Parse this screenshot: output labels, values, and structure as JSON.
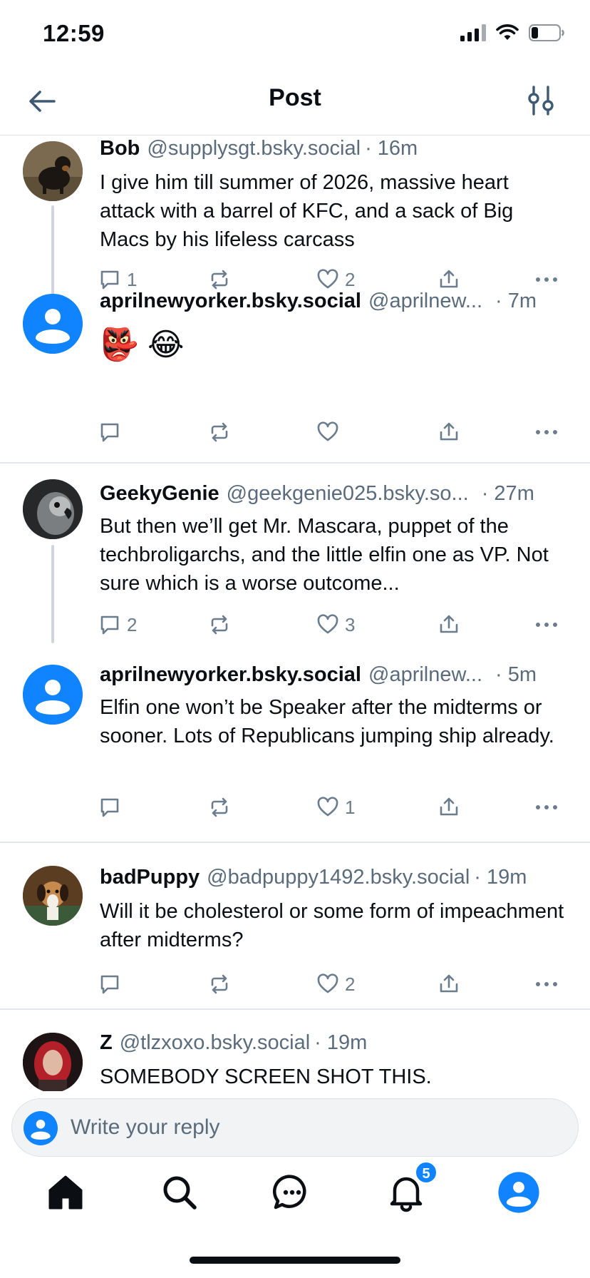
{
  "status_bar": {
    "time": "12:59"
  },
  "header": {
    "title": "Post"
  },
  "posts": [
    {
      "name": "Bob",
      "handle": "@supplysgt.bsky.social",
      "time": "· 16m",
      "text": "I give him till summer of 2026, massive heart attack with a barrel of KFC, and a sack of Big Macs by his lifeless carcass",
      "replies": "1",
      "likes": "2"
    },
    {
      "name": "aprilnewyorker.bsky.social",
      "handle": "@aprilnew...",
      "time": "· 7m",
      "text": "👺 😂",
      "replies": "",
      "likes": ""
    },
    {
      "name": "GeekyGenie",
      "handle": "@geekgenie025.bsky.so...",
      "time": "· 27m",
      "text": "But then we’ll get Mr. Mascara, puppet of the techbroligarchs, and the little elfin one as VP. Not sure which is a worse outcome...",
      "replies": "2",
      "likes": "3"
    },
    {
      "name": "aprilnewyorker.bsky.social",
      "handle": "@aprilnew...",
      "time": "· 5m",
      "text": "Elfin one won’t be Speaker after the midterms or sooner. Lots of Republicans jumping ship already.",
      "replies": "",
      "likes": "1"
    },
    {
      "name": "badPuppy",
      "handle": "@badpuppy1492.bsky.social",
      "time": "· 19m",
      "text": "Will it be cholesterol or some form of impeachment after midterms?",
      "replies": "",
      "likes": "2"
    },
    {
      "name": "Z",
      "handle": "@tlzxoxo.bsky.social",
      "time": "· 19m",
      "text": "SOMEBODY SCREEN SHOT THIS."
    }
  ],
  "reply_bar": {
    "placeholder": "Write your reply"
  },
  "tabbar": {
    "notifications_badge": "5"
  },
  "colors": {
    "accent": "#1083fe",
    "muted": "#5a6b7c",
    "divider": "#e3e7ec"
  },
  "icons": [
    "back-arrow-icon",
    "settings-sliders-icon",
    "reply-icon",
    "repost-icon",
    "like-icon",
    "share-icon",
    "more-icon",
    "home-icon",
    "search-icon",
    "chat-icon",
    "bell-icon",
    "profile-icon"
  ]
}
